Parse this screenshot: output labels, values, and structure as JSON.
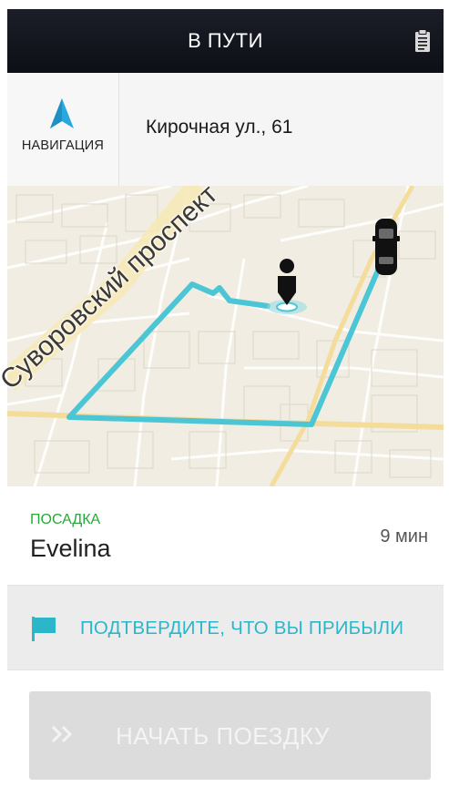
{
  "header": {
    "title": "В ПУТИ",
    "icon": "clipboard-icon"
  },
  "navbar": {
    "nav_label": "НАВИГАЦИЯ",
    "nav_icon": "navigation-arrow-icon",
    "address": "Кирочная ул., 61",
    "street_watermark": "Суворовский проспект"
  },
  "map": {
    "street_label": "Суворовский проспект",
    "route_color": "#4cc6d5",
    "pin_icon": "rider-pin-icon",
    "car_icon": "car-icon"
  },
  "pickup": {
    "label": "ПОСАДКА",
    "rider": "Evelina",
    "eta": "9 мин"
  },
  "confirm": {
    "label": "ПОДТВЕРДИТЕ, ЧТО ВЫ ПРИБЫЛИ",
    "icon": "flag-icon"
  },
  "start": {
    "label": "НАЧАТЬ ПОЕЗДКУ",
    "icon": "double-chevron-icon"
  },
  "colors": {
    "accent": "#2bb6c9",
    "pickup_green": "#28a83b",
    "header_bg": "#12141c"
  }
}
